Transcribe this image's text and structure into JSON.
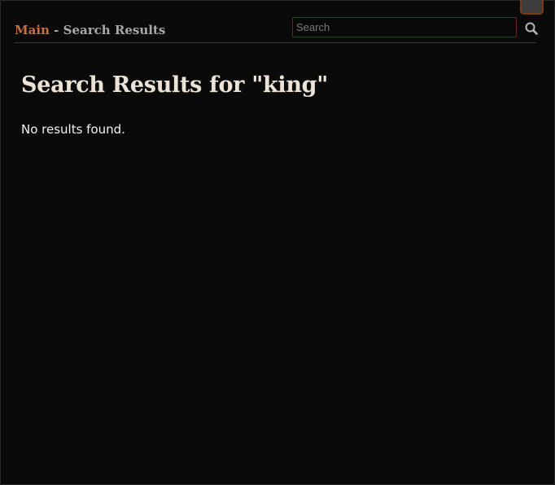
{
  "header": {
    "breadcrumb_home": "Main",
    "breadcrumb_separator": " - ",
    "breadcrumb_current": "Search Results"
  },
  "search": {
    "placeholder": "Search",
    "value": "",
    "button_icon": "search-icon"
  },
  "main": {
    "title": "Search Results for \"king\"",
    "message": "No results found."
  },
  "colors": {
    "background": "#0a0a0a",
    "accent": "#c8713f",
    "title": "#ebe3d8",
    "muted_text": "#a8a8a8",
    "input_border": "#5a2f18"
  }
}
